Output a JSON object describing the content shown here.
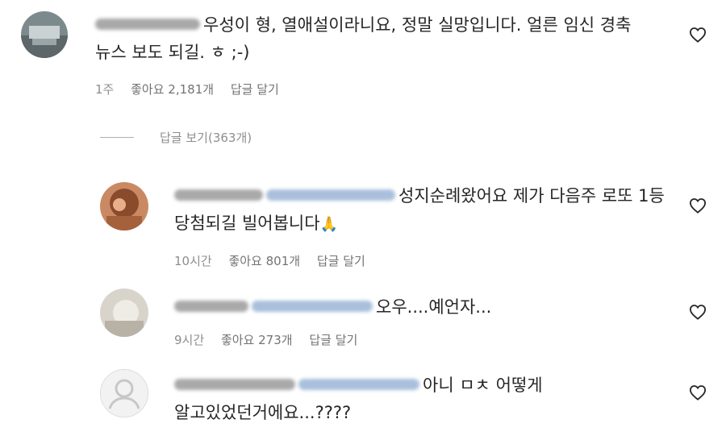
{
  "comments": [
    {
      "text": "우성이 형, 열애설이라니요, 정말 실망입니다. 얼른 임신 경축 뉴스 보도 되길. ㅎ ;-)",
      "time": "1주",
      "likes": "좋아요 2,181개",
      "reply": "답글 달기"
    },
    {
      "text": "성지순례왔어요 제가 다음주 로또 1등 당첨되길 빌어봅니다",
      "emoji": "🙏",
      "time": "10시간",
      "likes": "좋아요 801개",
      "reply": "답글 달기"
    },
    {
      "text": "오우....예언자...",
      "time": "9시간",
      "likes": "좋아요 273개",
      "reply": "답글 달기"
    },
    {
      "text": "아니 ㅁㅊ 어떻게 알고있었던거에요...????"
    }
  ],
  "view_replies": "답글 보기(363개)",
  "icons": {
    "heart": "heart-outline-icon"
  },
  "colors": {
    "text": "#262626",
    "meta": "#8e8e8e",
    "mention": "#00376b"
  }
}
